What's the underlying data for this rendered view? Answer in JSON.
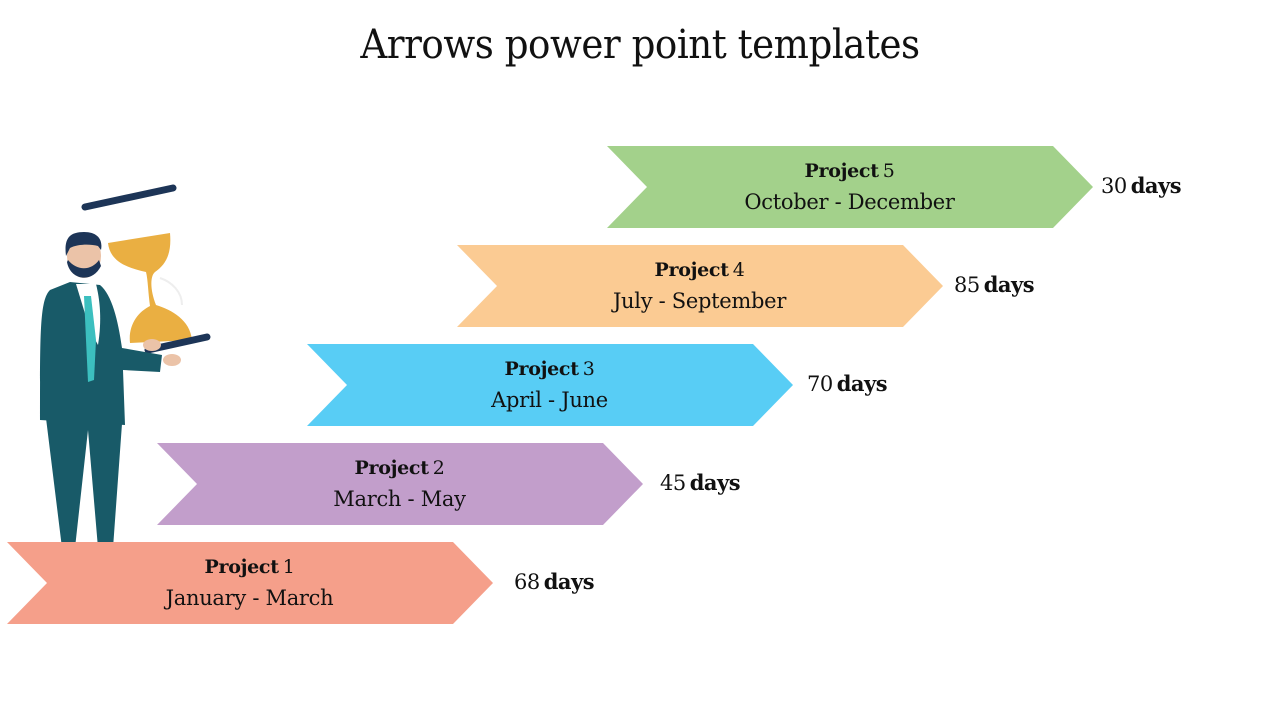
{
  "title": "Arrows power point templates",
  "projects": [
    {
      "label": "Project",
      "number": "1",
      "range": "January - March",
      "days_value": "68",
      "days_unit": "days",
      "color": "#F59F8A"
    },
    {
      "label": "Project",
      "number": "2",
      "range": "March - May",
      "days_value": "45",
      "days_unit": "days",
      "color": "#C29ECB"
    },
    {
      "label": "Project",
      "number": "3",
      "range": "April - June",
      "days_value": "70",
      "days_unit": "days",
      "color": "#58CDF5"
    },
    {
      "label": "Project",
      "number": "4",
      "range": "July - September",
      "days_value": "85",
      "days_unit": "days",
      "color": "#FBCB93"
    },
    {
      "label": "Project",
      "number": "5",
      "range": "October - December",
      "days_value": "30",
      "days_unit": "days",
      "color": "#A3D18B"
    }
  ],
  "illustration": {
    "subject": "businessman holding hourglass",
    "colors": {
      "suit": "#185A68",
      "hair": "#1D3557",
      "skin": "#EBC3A8",
      "hourglass": "#EAAF42",
      "tie": "#3CBFBF",
      "bar": "#1D3557"
    }
  }
}
